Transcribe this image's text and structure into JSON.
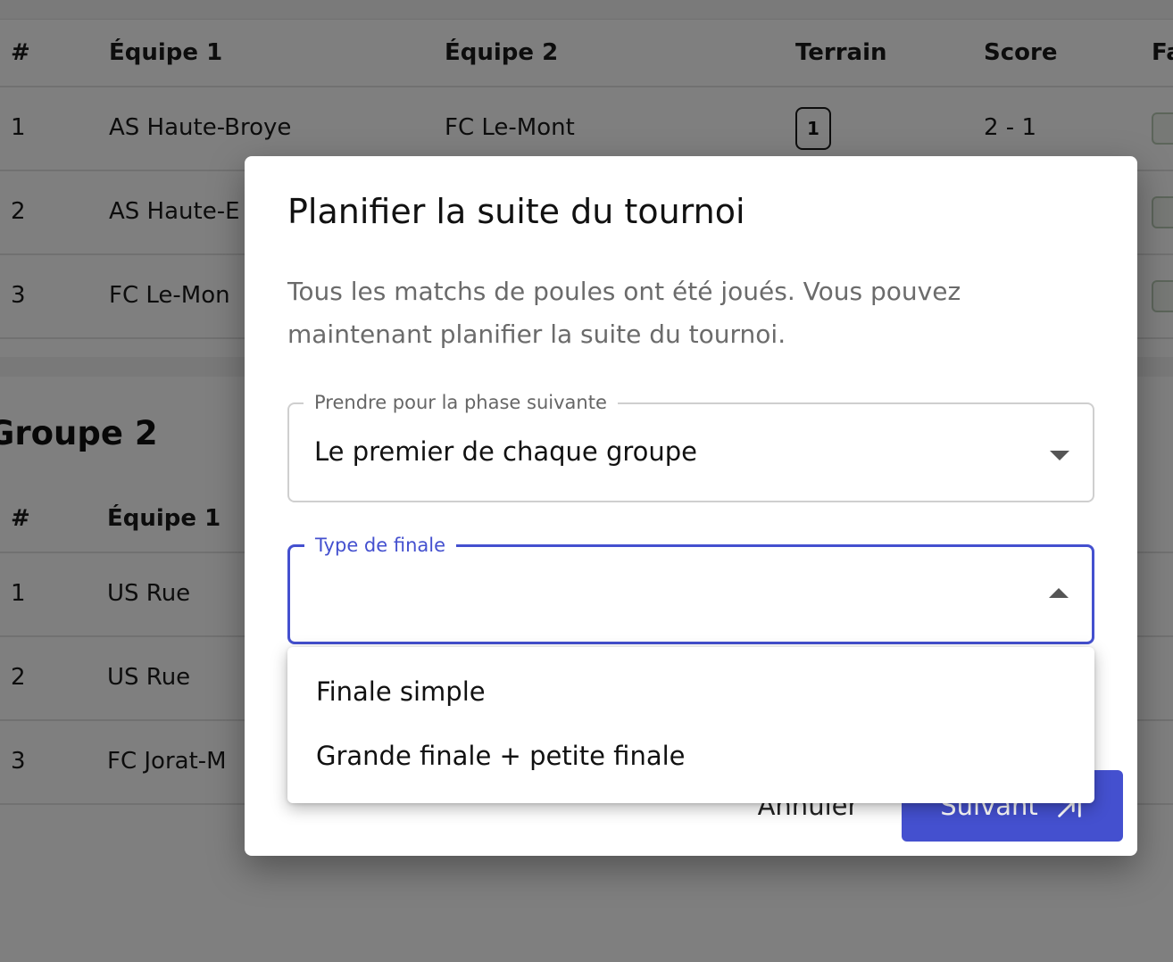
{
  "background": {
    "table_top": {
      "headers": [
        "#",
        "Équipe 1",
        "Équipe 2",
        "Terrain",
        "Score",
        "Fa"
      ],
      "rows": [
        {
          "num": "1",
          "team1": "AS Haute-Broye",
          "team2": "FC Le-Mont",
          "terrain": "1",
          "score": "2 - 1"
        },
        {
          "num": "2",
          "team1": "AS Haute-E"
        },
        {
          "num": "3",
          "team1": "FC Le-Mon"
        }
      ]
    },
    "group_title": "Groupe 2",
    "table_bottom": {
      "headers": [
        "#",
        "Équipe 1"
      ],
      "rows": [
        {
          "num": "1",
          "team1": "US Rue"
        },
        {
          "num": "2",
          "team1": "US Rue"
        },
        {
          "num": "3",
          "team1": "FC Jorat-M"
        }
      ]
    }
  },
  "dialog": {
    "title": "Planifier la suite du tournoi",
    "description": "Tous les matchs de poules ont été joués. Vous pouvez maintenant planifier la suite du tournoi.",
    "next_phase": {
      "label": "Prendre pour la phase suivante",
      "value": "Le premier de chaque groupe"
    },
    "final_type": {
      "label": "Type de finale",
      "value": "",
      "options": [
        "Finale simple",
        "Grande finale + petite finale"
      ]
    },
    "cancel_label": "Annuler",
    "next_label": "Suivant",
    "accent_color": "#4450cf"
  }
}
